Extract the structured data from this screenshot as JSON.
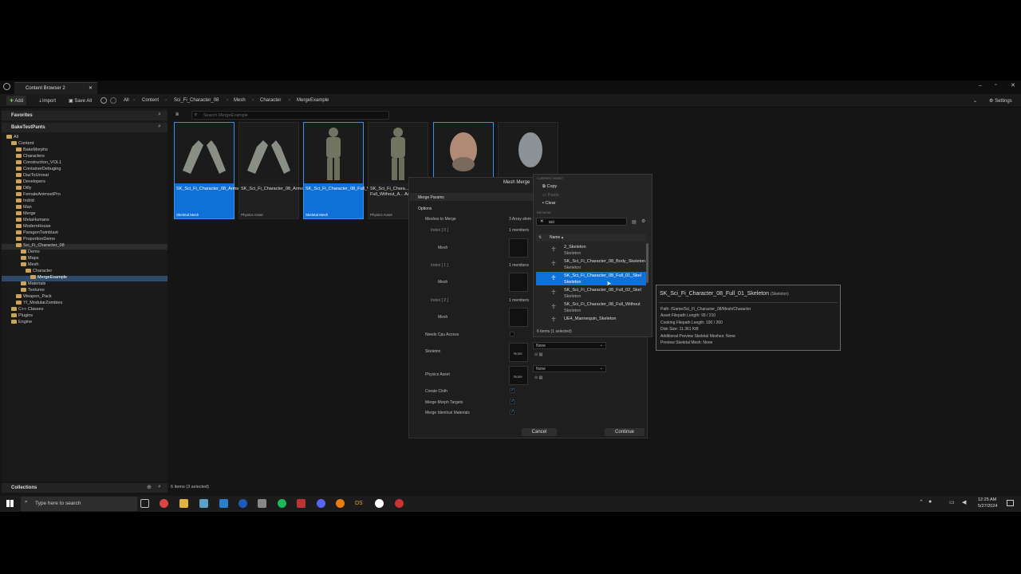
{
  "window": {
    "tab_title": "Content Browser 2"
  },
  "toolbar": {
    "add": "Add",
    "import": "Import",
    "save_all": "Save All",
    "settings": "Settings"
  },
  "breadcrumb": [
    "All",
    "Content",
    "Sci_Fi_Character_08",
    "Mesh",
    "Character",
    "MergeExample"
  ],
  "search": {
    "placeholder": "Search MergeExample"
  },
  "sidebar": {
    "favorites": "Favorites",
    "project": "BakeTestPants",
    "collections": "Collections",
    "tree": [
      "All",
      "Content",
      "BakeMorphs",
      "Characters",
      "Construction_VOL1",
      "ContainerDebuging",
      "DazToUnreal",
      "Developers",
      "Dilly",
      "FemaleAnimsetPro",
      "Indrid",
      "Man",
      "Merge",
      "MetaHumans",
      "ModernHouse",
      "ParagonTwinblast",
      "ProportionDemo",
      "Sci_Fi_Character_08",
      "Demo",
      "Maps",
      "Mesh",
      "Character",
      "MergeExample",
      "Materials",
      "Textures",
      "Weapon_Pack",
      "YI_ModularZombies",
      "C++ Classes",
      "Plugins",
      "Engine"
    ]
  },
  "assets": [
    {
      "name": "SK_Sci_Fi_Character_08_Arms",
      "type": "Skeletal Mesh",
      "selected": true
    },
    {
      "name": "SK_Sci_Fi_Character_08_Arms_PhysicsAsset",
      "type": "Physics Asset",
      "selected": false
    },
    {
      "name": "SK_Sci_Fi_Character_08_Full_Without_Arms",
      "type": "Skeletal Mesh",
      "selected": true
    },
    {
      "name": "SK_Sci_Fi_Chara... Full_Without_A... Asset",
      "type": "Physics Asset",
      "selected": false
    },
    {
      "name": "",
      "type": "",
      "selected": true
    },
    {
      "name": "",
      "type": "",
      "selected": false
    }
  ],
  "status": "6 items (3 selected)",
  "dialog": {
    "title": "Mesh Merge",
    "merge_params": "Merge Params",
    "options": "Options",
    "meshes_to_merge": "Meshes to Merge",
    "meshes_count": "3 Array elem",
    "index0": "Index [ 0 ]",
    "index1": "Index [ 1 ]",
    "index2": "Index [ 2 ]",
    "members": "1 members",
    "mesh": "Mesh",
    "needs_cpu": "Needs Cpu Access",
    "skeleton": "Skeleton",
    "physics_asset": "Physics Asset",
    "create_cloth": "Create Cloth",
    "merge_morph": "Merge Morph Targets",
    "merge_materials": "Merge Identical Materials",
    "none": "None",
    "cancel": "Cancel",
    "continue": "Continue"
  },
  "picker": {
    "current_asset": "CURRENT ASSET",
    "copy": "Copy",
    "paste": "Paste",
    "clear": "Clear",
    "browse": "BROWSE",
    "search_value": "sci",
    "name_col": "Name",
    "items": [
      {
        "name": "2_Skeleton",
        "type": "Skeleton",
        "selected": false
      },
      {
        "name": "SK_Sci_Fi_Character_08_Body_Skeleton",
        "type": "Skeleton",
        "selected": false
      },
      {
        "name": "SK_Sci_Fi_Character_08_Full_01_Skel",
        "type": "Skeleton",
        "selected": true
      },
      {
        "name": "SK_Sci_Fi_Character_08_Full_02_Skel",
        "type": "Skeleton",
        "selected": false
      },
      {
        "name": "SK_Sci_Fi_Character_08_Full_Without",
        "type": "Skeleton",
        "selected": false
      },
      {
        "name": "UE4_Mannequin_Skeleton",
        "type": "",
        "selected": false
      }
    ],
    "count": "6 items (1 selected)"
  },
  "tooltip": {
    "title": "SK_Sci_Fi_Character_08_Full_01_Skeleton",
    "title_type": "(Skeleton)",
    "path": "Path: /Game/Sci_Fi_Character_08/Mesh/Character",
    "asset_filepath": "Asset Filepath Length: 99 / 210",
    "cooking_filepath": "Cooking Filepath Length: 190 / 260",
    "disk_size": "Disk Size: 11.361 KiB",
    "additional": "Additional Preview Skeletal Meshes: None",
    "preview": "Preview Skeletal Mesh: None"
  },
  "taskbar": {
    "search": "Type here to search",
    "time": "12:25 AM",
    "date": "5/27/2024"
  }
}
